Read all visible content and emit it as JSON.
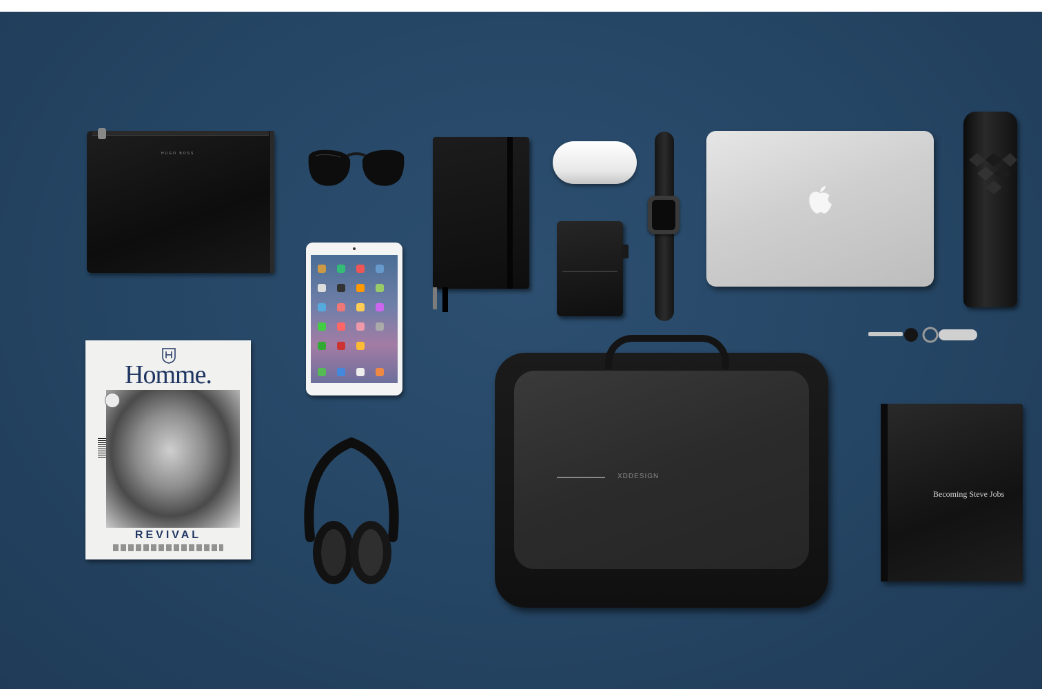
{
  "scene": {
    "background_color": "#254564",
    "accent_navy": "#1f3662"
  },
  "pouch": {
    "brand_text": "HUGO BOSS"
  },
  "magazine": {
    "masthead": "Homme.",
    "cover_headline": "REVIVAL"
  },
  "backpack": {
    "brand_text": "XDDESIGN"
  },
  "book": {
    "title": "Becoming Steve Jobs"
  },
  "icons": {
    "laptop_logo": "apple-logo-icon",
    "magazine_crest": "crest-icon"
  }
}
